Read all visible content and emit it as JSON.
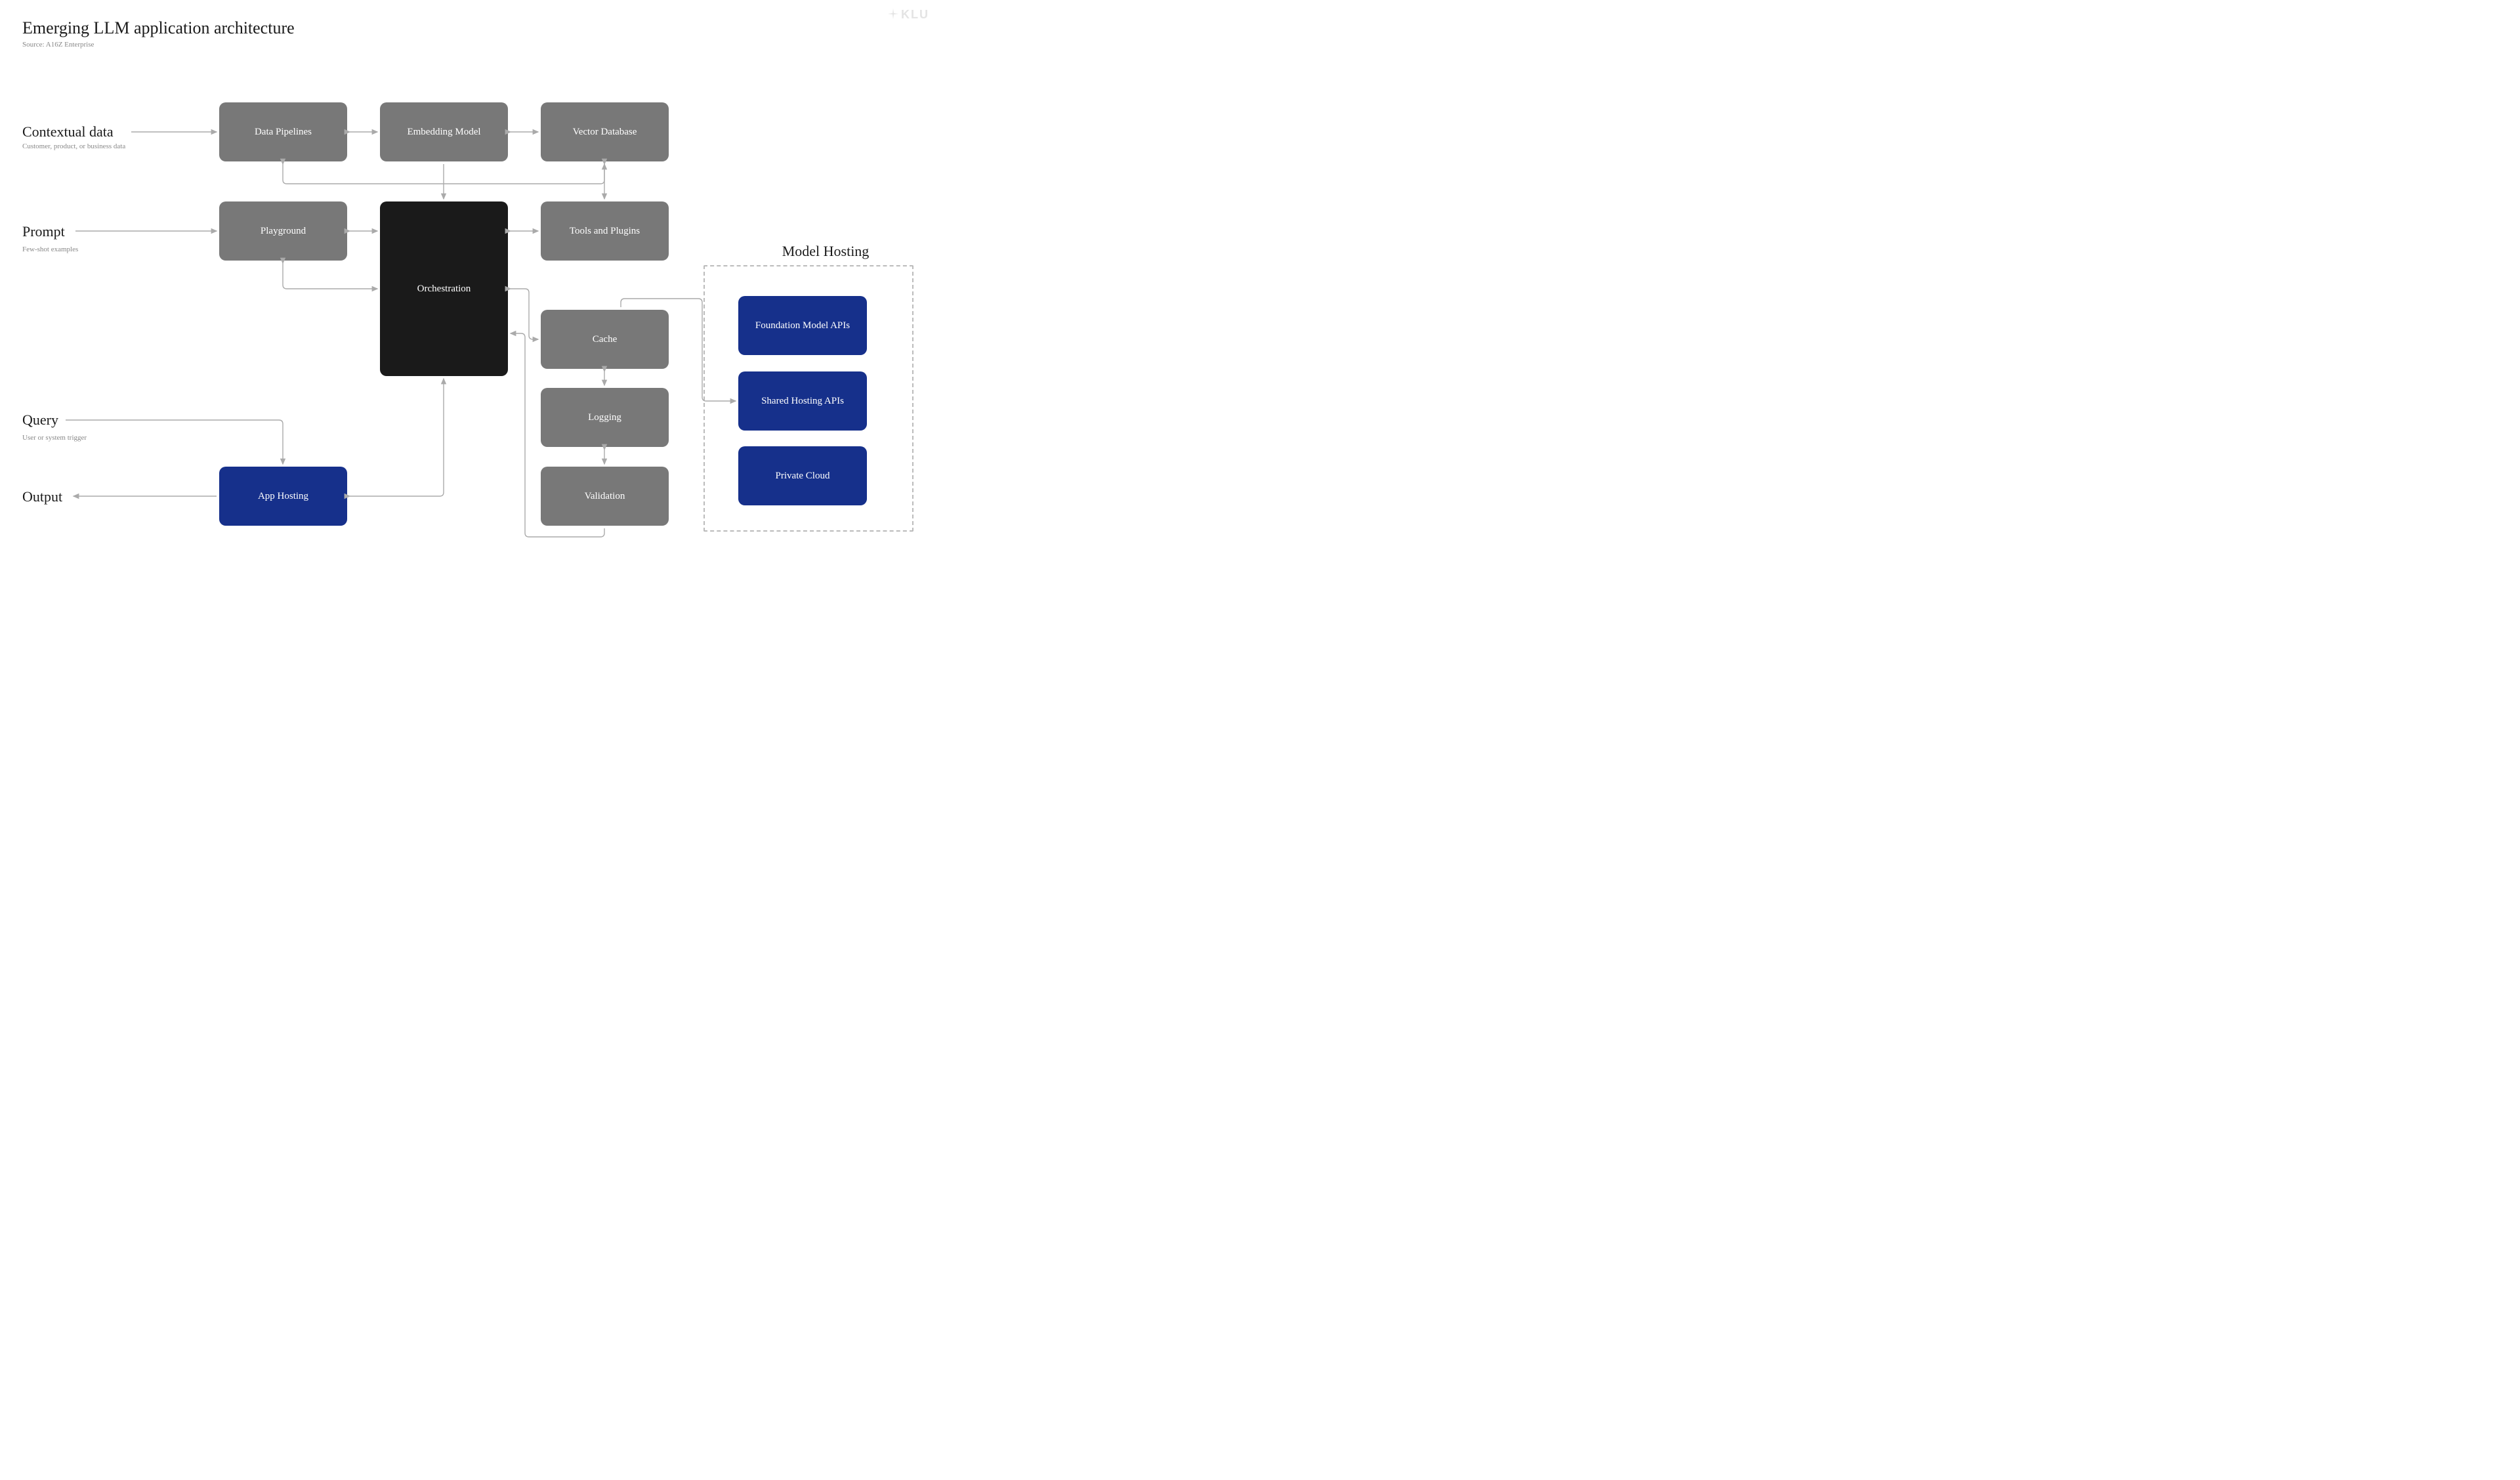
{
  "title": "Emerging LLM application architecture",
  "source": "Source: A16Z Enterprise",
  "brand": "KLU",
  "sections": {
    "contextual": {
      "label": "Contextual data",
      "sub": "Customer, product, or business data"
    },
    "prompt": {
      "label": "Prompt",
      "sub": "Few-shot examples"
    },
    "query": {
      "label": "Query",
      "sub": "User or system trigger"
    },
    "output": {
      "label": "Output"
    }
  },
  "nodes": {
    "data_pipelines": "Data Pipelines",
    "embedding_model": "Embedding Model",
    "vector_database": "Vector Database",
    "playground": "Playground",
    "orchestration": "Orchestration",
    "tools_plugins": "Tools and Plugins",
    "cache": "Cache",
    "logging": "Logging",
    "validation": "Validation",
    "app_hosting": "App Hosting"
  },
  "hosting": {
    "title": "Model Hosting",
    "items": [
      "Foundation Model APIs",
      "Shared Hosting APIs",
      "Private Cloud"
    ]
  }
}
